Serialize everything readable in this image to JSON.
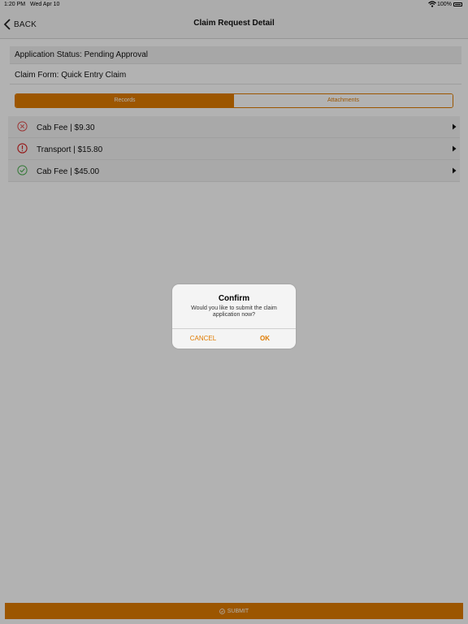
{
  "status_bar": {
    "time": "1:20 PM",
    "date": "Wed Apr 10",
    "battery": "100%"
  },
  "nav": {
    "back_label": "BACK",
    "title": "Claim Request Detail"
  },
  "info": {
    "status": "Application Status: Pending Approval",
    "form": "Claim Form: Quick Entry Claim"
  },
  "tabs": {
    "records": "Records",
    "attachments": "Attachments",
    "selected": "Records"
  },
  "records": [
    {
      "label": "Cab Fee | $9.30",
      "status": "rejected",
      "icon": "x-circle-icon",
      "color": "#e05050"
    },
    {
      "label": "Transport | $15.80",
      "status": "warning",
      "icon": "exclamation-circle-icon",
      "color": "#d62020"
    },
    {
      "label": "Cab Fee | $45.00",
      "status": "approved",
      "icon": "check-circle-icon",
      "color": "#4caf50"
    }
  ],
  "submit": {
    "label": "SUBMIT"
  },
  "alert": {
    "title": "Confirm",
    "message": "Would you like to submit the claim application now?",
    "cancel": "CANCEL",
    "ok": "OK"
  },
  "colors": {
    "accent": "#e07b00",
    "submit_bg": "#a35500"
  }
}
